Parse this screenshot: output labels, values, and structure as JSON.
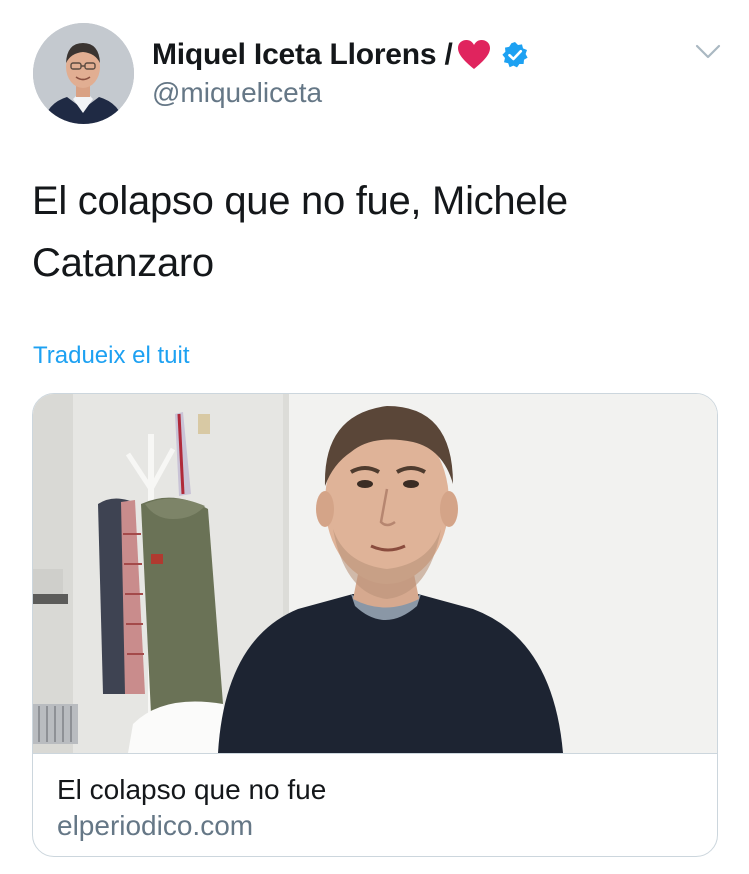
{
  "tweet": {
    "author": {
      "display_name": "Miquel Iceta Llorens /",
      "display_name_emoji": "heart-emoji",
      "verified_badge": "verified-badge-icon",
      "handle": "@miqueliceta"
    },
    "menu_icon": "chevron-down-icon",
    "text": "El colapso que no fue, Michele Catanzaro",
    "translate_link": "Tradueix el tuit",
    "card": {
      "image": "photo-man-in-dark-sweater",
      "title": "El colapso que no fue",
      "domain": "elperiodico.com"
    }
  },
  "colors": {
    "link": "#1da1f2",
    "secondary_text": "#657786",
    "primary_text": "#14171a",
    "border": "#ccd6dd",
    "verified": "#1da1f2",
    "heart": "#e0245e"
  }
}
